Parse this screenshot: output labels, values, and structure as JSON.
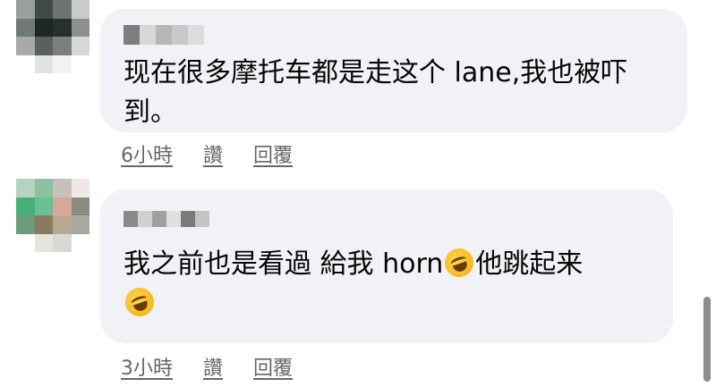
{
  "comments": [
    {
      "text": "现在很多摩托车都是走这个 lane,我也被吓到。",
      "time": "6小時",
      "like_label": "讚",
      "reply_label": "回覆"
    },
    {
      "text_main": "我之前也是看過 給我 horn",
      "emoji_name": "rolling-on-floor-laughing",
      "text_tail": "他跳起来",
      "time": "3小時",
      "like_label": "讚",
      "reply_label": "回覆"
    }
  ],
  "colors": {
    "bubble": "#f0f2f5",
    "text": "#050505",
    "meta": "#65676b"
  }
}
